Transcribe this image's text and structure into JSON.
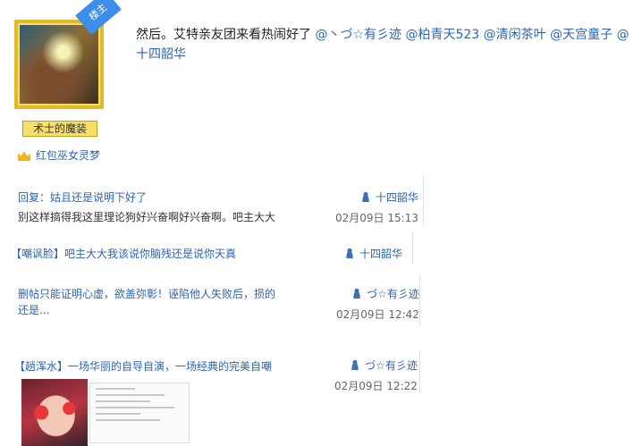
{
  "post": {
    "badge": "楼主",
    "title_badge": "术士的魔装",
    "sub_user": "红包巫女灵梦",
    "text": "然后。艾特亲友团来看热闹好了",
    "mentions": [
      "@丶づ☆有彡迹",
      "@柏青天523",
      "@清闲茶叶",
      "@天宫童子",
      "@十四韶华"
    ]
  },
  "replies": [
    {
      "title": "回复：姑且还是说明下好了",
      "snippet": "别这样搞得我这里理论狗好兴奋啊好兴奋啊。吧主大大",
      "author": "十四韶华",
      "date": "02月09日 15:13"
    },
    {
      "title": "【嘲讽脸】吧主大大我该说你脑残还是说你天真",
      "snippet": "",
      "author": "十四韶华",
      "date": ""
    },
    {
      "title": "删帖只能证明心虚，欲盖弥彰！诬陷他人失败后，损的还是...",
      "snippet": "",
      "author": "づ☆有彡迹",
      "date": "02月09日 12:42"
    },
    {
      "title": "【趟浑水】一场华丽的自导自演，一场经典的完美自嘲",
      "snippet": "",
      "author": "づ☆有彡迹",
      "date": "02月09日 12:22"
    }
  ],
  "icons": {
    "user": "user-icon",
    "crown": "crown-icon"
  },
  "colors": {
    "link": "#2d64b3",
    "badge": "#3d8ee8",
    "avatar_frame": "#e1b92a"
  }
}
